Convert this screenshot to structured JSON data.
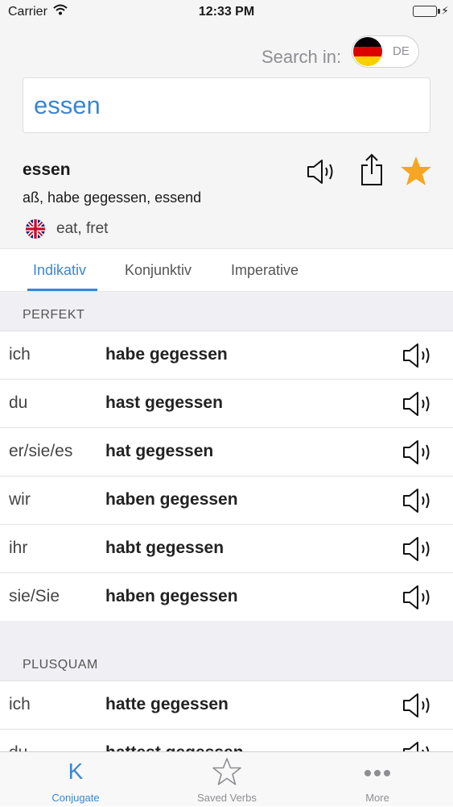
{
  "status_bar": {
    "carrier": "Carrier",
    "time": "12:33 PM"
  },
  "search": {
    "label": "Search in:",
    "language_code": "DE",
    "query": "essen"
  },
  "verb": {
    "infinitive": "essen",
    "forms": "aß, habe gegessen, essend",
    "translation": "eat, fret"
  },
  "mood_tabs": [
    {
      "label": "Indikativ",
      "active": true
    },
    {
      "label": "Konjunktiv",
      "active": false
    },
    {
      "label": "Imperative",
      "active": false
    }
  ],
  "sections": [
    {
      "title": "PERFEKT",
      "rows": [
        {
          "pronoun": "ich",
          "form": "habe gegessen"
        },
        {
          "pronoun": "du",
          "form": "hast gegessen"
        },
        {
          "pronoun": "er/sie/es",
          "form": "hat gegessen"
        },
        {
          "pronoun": "wir",
          "form": "haben gegessen"
        },
        {
          "pronoun": "ihr",
          "form": "habt gegessen"
        },
        {
          "pronoun": "sie/Sie",
          "form": "haben gegessen"
        }
      ]
    },
    {
      "title": "PLUSQUAM",
      "rows": [
        {
          "pronoun": "ich",
          "form": "hatte gegessen"
        },
        {
          "pronoun": "du",
          "form": "hattest gegessen"
        }
      ]
    }
  ],
  "tab_bar": [
    {
      "label": "Conjugate",
      "icon": "K",
      "active": true
    },
    {
      "label": "Saved Verbs",
      "icon": "star-icon",
      "active": false
    },
    {
      "label": "More",
      "icon": "more-icon",
      "active": false
    }
  ],
  "colors": {
    "accent": "#3a86d3",
    "favorite_star": "#f6a623",
    "battery": "#4cd964",
    "section_bg": "#efeff4"
  }
}
